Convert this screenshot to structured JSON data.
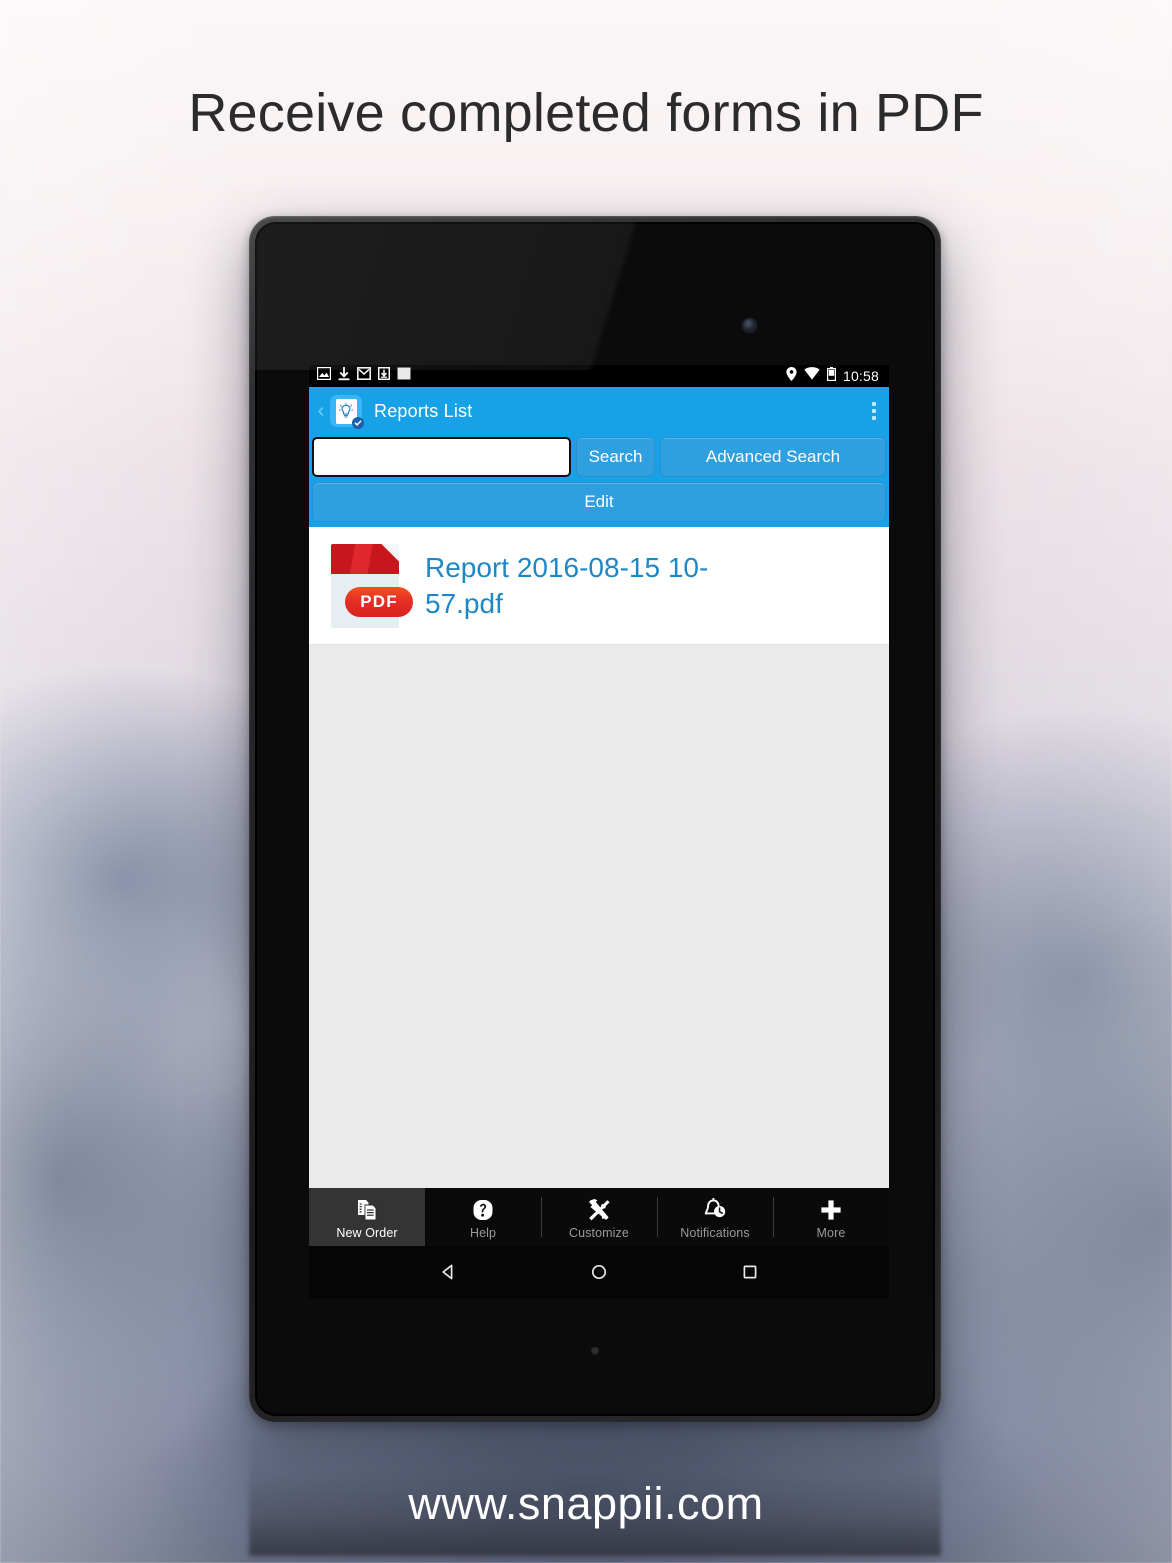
{
  "marketing": {
    "headline": "Receive completed forms in PDF",
    "footer_url": "www.snappii.com"
  },
  "colors": {
    "appbar_blue": "#17a2e8",
    "button_blue": "#2e9fdf",
    "link_blue": "#1e88c7",
    "pdf_red": "#d8221d",
    "content_gray": "#ebebeb",
    "tabbar_black": "#0a0a0a",
    "tab_active_bg": "#343434"
  },
  "statusbar": {
    "time": "10:58",
    "left_icons": [
      "screenshot-icon",
      "download-icon",
      "gmail-icon",
      "download-box-icon",
      "blank-notification-icon"
    ],
    "right_icons": [
      "location-icon",
      "wifi-icon",
      "battery-icon"
    ]
  },
  "appbar": {
    "title": "Reports List",
    "back_label": "‹",
    "app_icon": "document-lightbulb-icon",
    "overflow_label": "overflow-menu"
  },
  "search": {
    "value": "",
    "placeholder": "",
    "search_button": "Search",
    "advanced_button": "Advanced Search",
    "edit_button": "Edit"
  },
  "file_list": {
    "items": [
      {
        "name": "Report 2016-08-15 10-57.pdf",
        "icon": "pdf-file-icon",
        "badge": "PDF"
      }
    ]
  },
  "tabbar": {
    "tabs": [
      {
        "label": "New Order",
        "icon": "documents-icon",
        "active": true
      },
      {
        "label": "Help",
        "icon": "question-mark-icon",
        "active": false
      },
      {
        "label": "Customize",
        "icon": "wrench-hammer-icon",
        "active": false
      },
      {
        "label": "Notifications",
        "icon": "bell-clock-icon",
        "active": false
      },
      {
        "label": "More",
        "icon": "plus-icon",
        "active": false
      }
    ]
  },
  "navbar": {
    "back": "back-triangle-icon",
    "home": "home-circle-icon",
    "recents": "recents-square-icon"
  }
}
